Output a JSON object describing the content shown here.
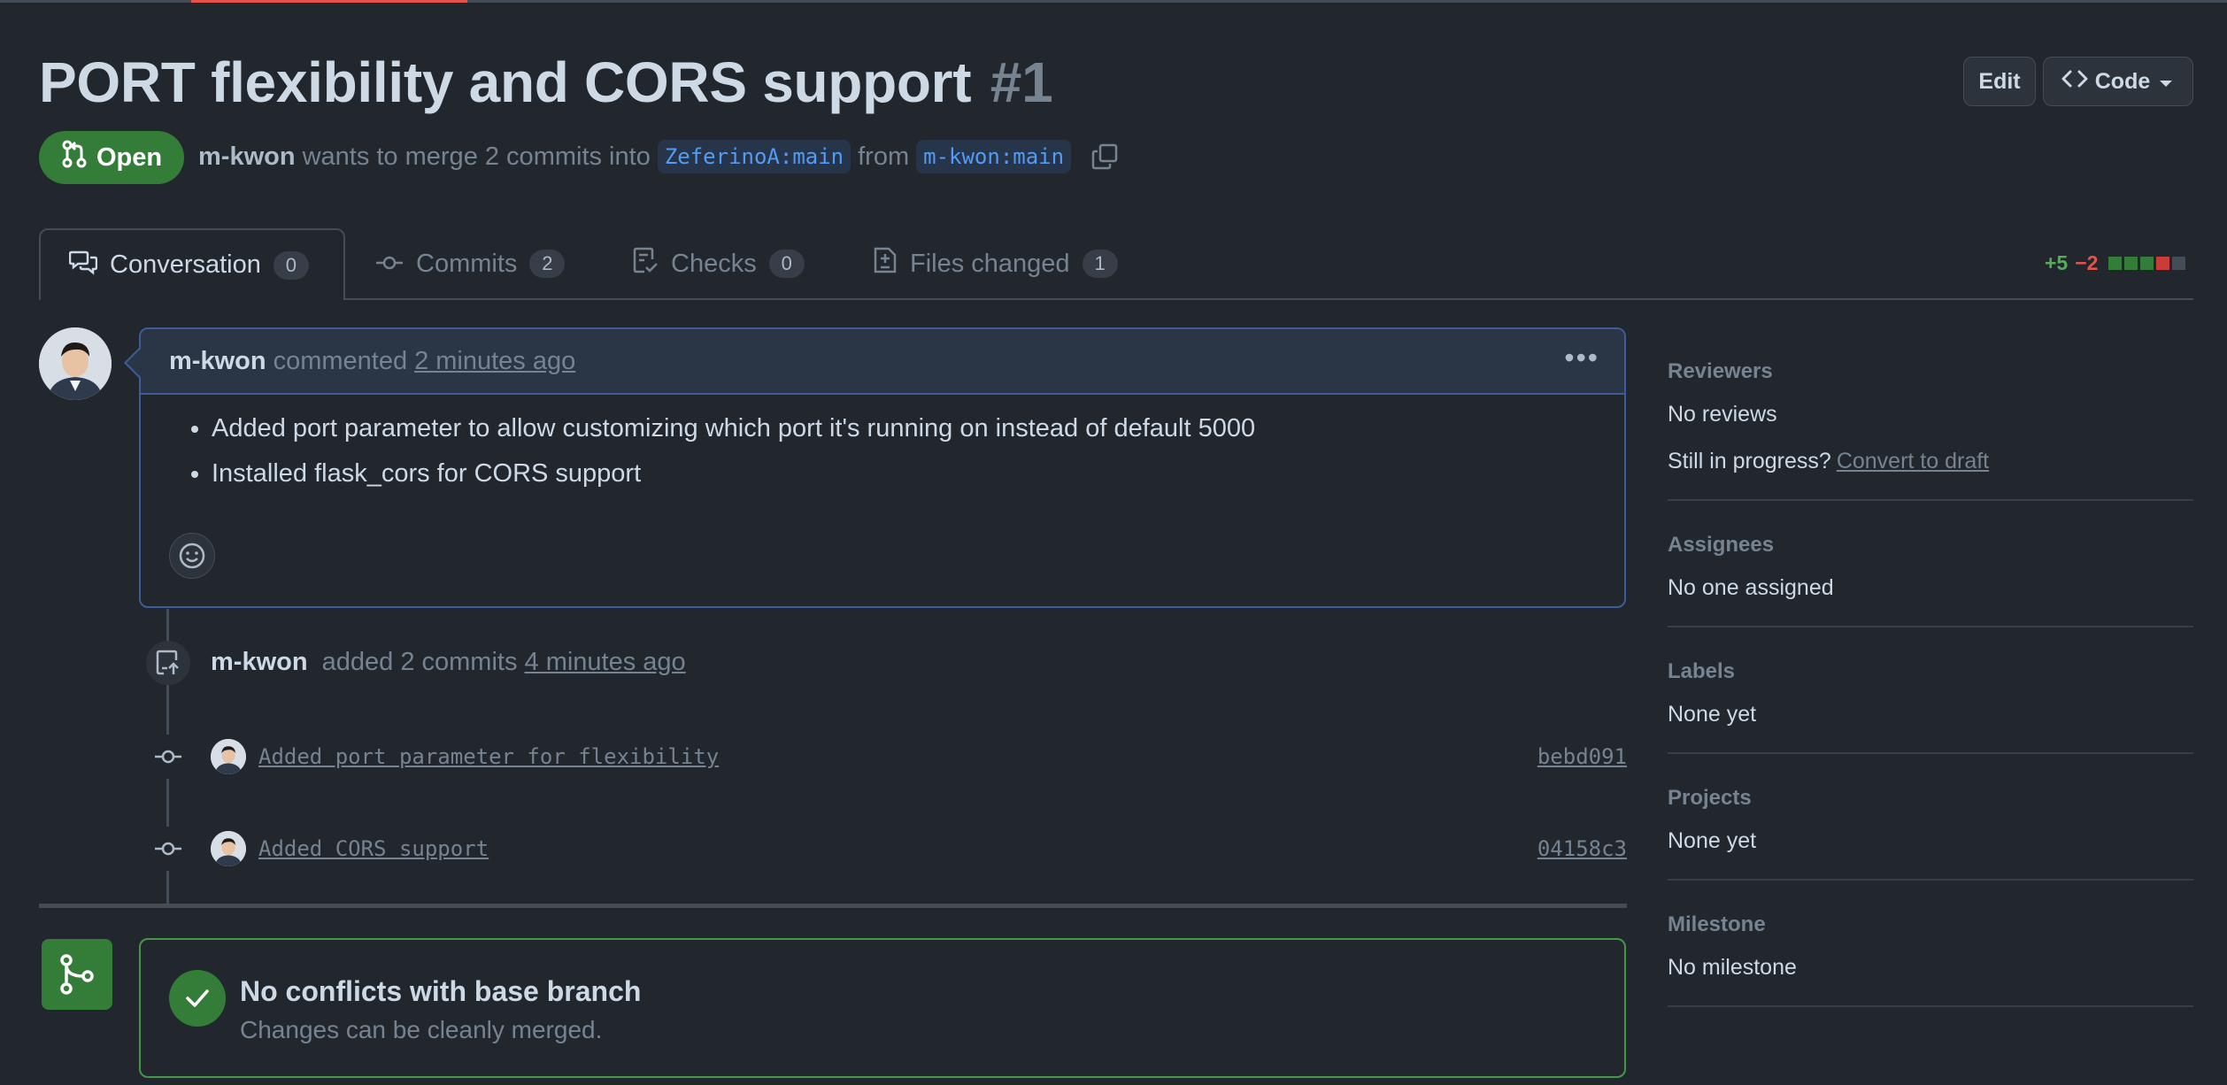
{
  "pr": {
    "title": "PORT flexibility and CORS support",
    "number": "#1",
    "state": "Open",
    "author": "m-kwon",
    "merge_text": "wants to merge 2 commits into",
    "base_branch": "ZeferinoA:main",
    "from_text": "from",
    "head_branch": "m-kwon:main"
  },
  "header_buttons": {
    "edit": "Edit",
    "code": "Code"
  },
  "tabs": [
    {
      "label": "Conversation",
      "count": "0"
    },
    {
      "label": "Commits",
      "count": "2"
    },
    {
      "label": "Checks",
      "count": "0"
    },
    {
      "label": "Files changed",
      "count": "1"
    }
  ],
  "diffstat": {
    "additions": "+5",
    "deletions": "−2"
  },
  "comment": {
    "author": "m-kwon",
    "action": "commented",
    "time": "2 minutes ago",
    "items": [
      "Added port parameter to allow customizing which port it's running on instead of default 5000",
      "Installed flask_cors for CORS support"
    ]
  },
  "timeline": {
    "event": {
      "author": "m-kwon",
      "action": "added 2 commits",
      "time": "4 minutes ago"
    },
    "commits": [
      {
        "message": "Added port parameter for flexibility",
        "sha": "bebd091"
      },
      {
        "message": "Added CORS support",
        "sha": "04158c3"
      }
    ]
  },
  "merge_status": {
    "title": "No conflicts with base branch",
    "subtitle": "Changes can be cleanly merged."
  },
  "sidebar": {
    "reviewers": {
      "heading": "Reviewers",
      "value": "No reviews",
      "progress_text": "Still in progress?",
      "draft_link": "Convert to draft"
    },
    "assignees": {
      "heading": "Assignees",
      "value": "No one assigned"
    },
    "labels": {
      "heading": "Labels",
      "value": "None yet"
    },
    "projects": {
      "heading": "Projects",
      "value": "None yet"
    },
    "milestone": {
      "heading": "Milestone",
      "value": "No milestone"
    }
  },
  "colors": {
    "open_green": "#347d39",
    "accent_blue": "#539bf5",
    "bg": "#22272e",
    "deletion_red": "#e5534b"
  }
}
